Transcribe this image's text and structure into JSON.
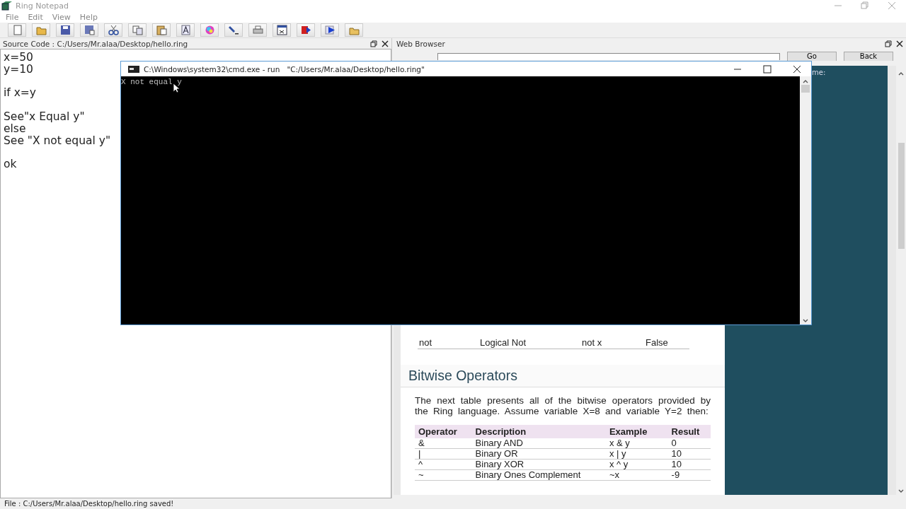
{
  "window": {
    "title": "Ring Notepad"
  },
  "menu": [
    "File",
    "Edit",
    "View",
    "Help"
  ],
  "toolbar": [
    {
      "kind": "new"
    },
    {
      "kind": "open"
    },
    {
      "kind": "save"
    },
    {
      "kind": "save_as"
    },
    {
      "kind": "cut"
    },
    {
      "kind": "copy"
    },
    {
      "kind": "paste"
    },
    {
      "kind": "font"
    },
    {
      "kind": "color"
    },
    {
      "kind": "torch"
    },
    {
      "kind": "print"
    },
    {
      "kind": "grid"
    },
    {
      "kind": "run_red"
    },
    {
      "kind": "run_blue"
    },
    {
      "kind": "folder"
    }
  ],
  "source_panel": {
    "title": "Source Code : C:/Users/Mr.alaa/Desktop/hello.ring",
    "blocks": [
      [
        "x=50",
        "y=10"
      ],
      [
        "if x=y"
      ],
      [
        "See\"x Equal y\"",
        "else",
        "See \"X not equal y\""
      ],
      [
        "ok"
      ]
    ]
  },
  "browser": {
    "title": "Web Browser",
    "buttons": [
      "Go",
      "Back"
    ],
    "side_text": "me:",
    "logical_rows": [
      {
        "operator": "not",
        "description": "Logical Not",
        "example": "not x",
        "result": "False"
      }
    ],
    "heading": "Bitwise Operators",
    "paragraph": "The next table presents all of the bitwise operators provided by the Ring language. Assume variable X=8 and variable Y=2 then:",
    "table": {
      "columns": [
        "Operator",
        "Description",
        "Example",
        "Result"
      ],
      "rows": [
        [
          "&",
          "Binary AND",
          "x & y",
          "0"
        ],
        [
          "|",
          "Binary OR",
          "x | y",
          "10"
        ],
        [
          "^",
          "Binary XOR",
          "x ^ y",
          "10"
        ],
        [
          "~",
          "Binary Ones Complement",
          "~x",
          "-9"
        ]
      ]
    }
  },
  "console": {
    "title": "C:\\Windows\\system32\\cmd.exe - run   \"C:/Users/Mr.alaa/Desktop/hello.ring\"",
    "output": "X not equal y"
  },
  "status_bar": "File : C:/Users/Mr.alaa/Desktop/hello.ring saved!"
}
